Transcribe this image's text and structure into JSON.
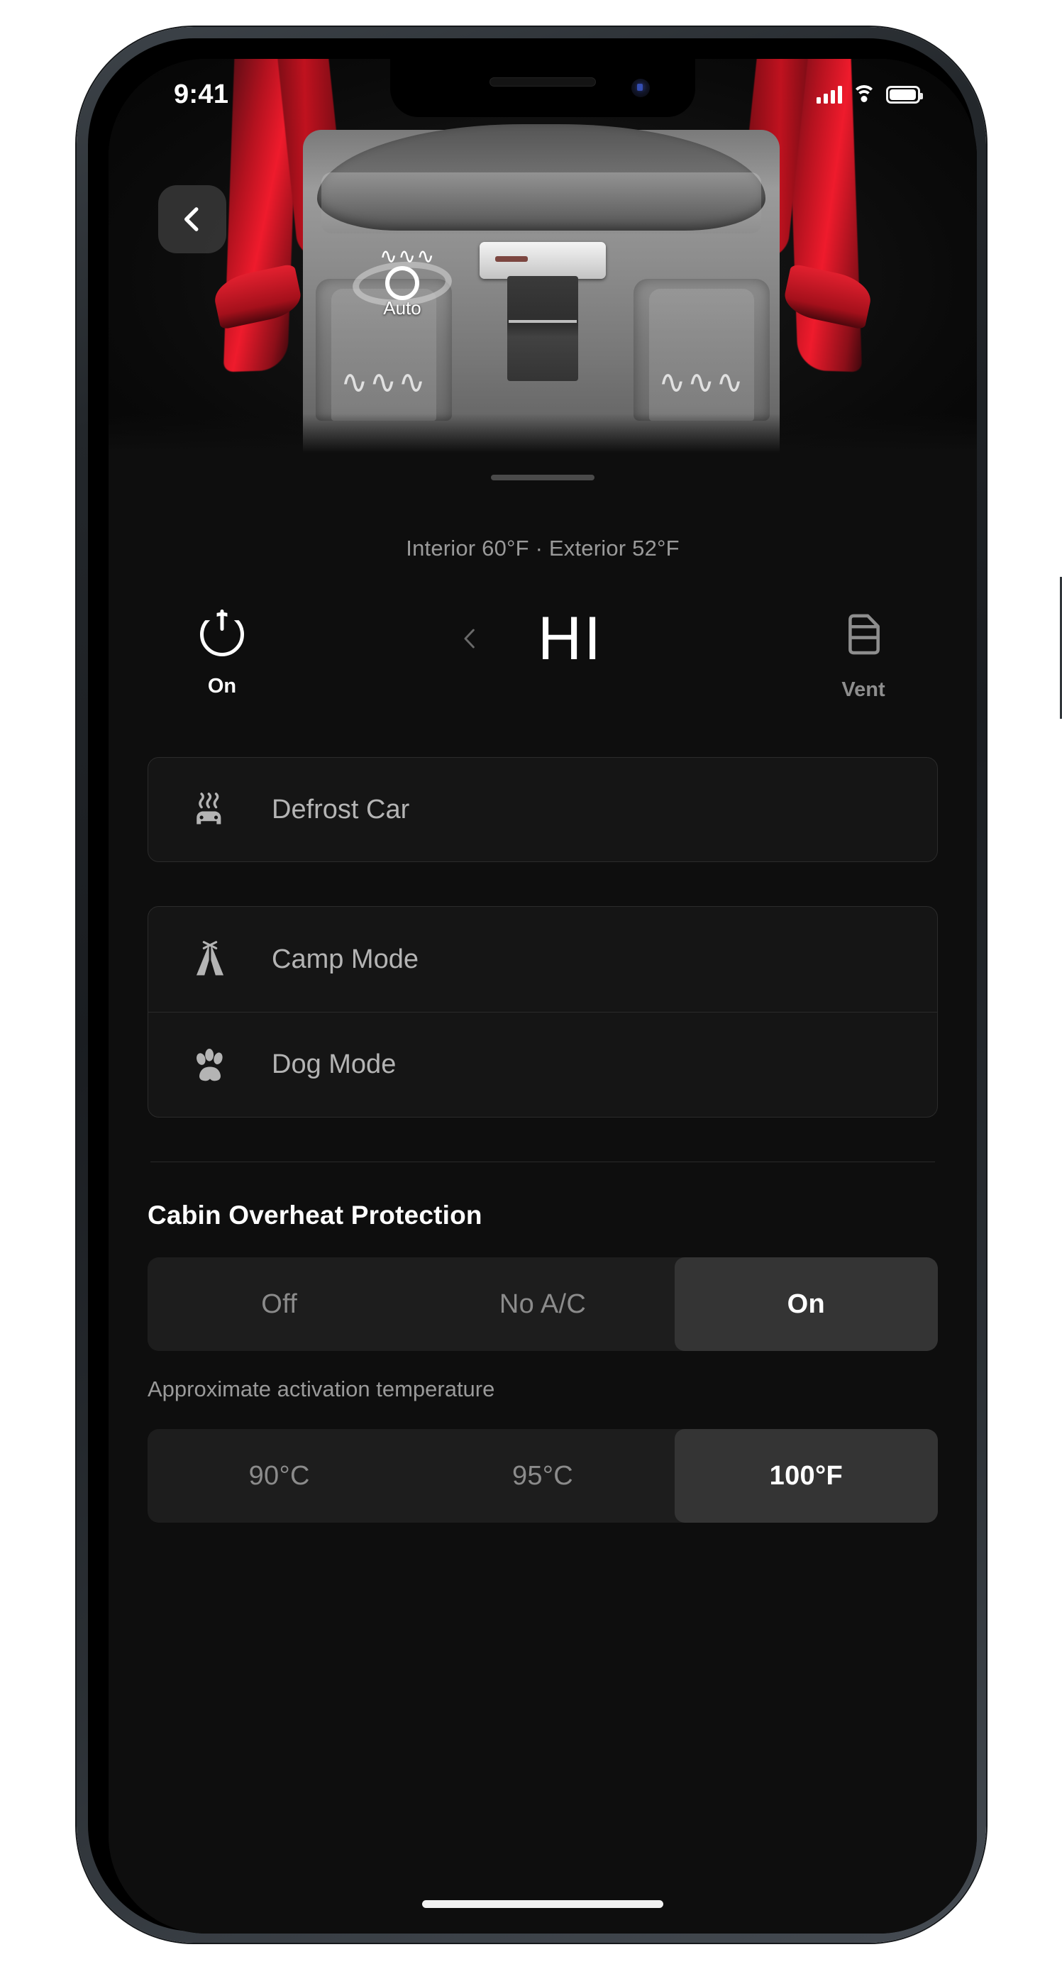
{
  "status_bar": {
    "time": "9:41",
    "cellular_icon": "cellular-signal-icon",
    "wifi_icon": "wifi-icon",
    "battery_icon": "battery-icon"
  },
  "hero": {
    "back_icon": "chevron-left-icon",
    "auto_label": "Auto",
    "steering_wheel_heat_icon": "steering-wheel-heat-icon",
    "left_seat_heat_icon": "seat-heater-icon",
    "right_seat_heat_icon": "seat-heater-icon",
    "car_color": "#ef1b2c"
  },
  "climate": {
    "temperature_readout": "Interior 60°F · Exterior 52°F",
    "power_icon": "power-icon",
    "power_label": "On",
    "temp_down_icon": "chevron-left-icon",
    "temp_value": "HI",
    "vent_icon": "car-door-vent-icon",
    "vent_label": "Vent"
  },
  "actions": {
    "defrost": {
      "label": "Defrost Car",
      "icon": "defrost-car-icon"
    },
    "camp": {
      "label": "Camp Mode",
      "icon": "tent-icon"
    },
    "dog": {
      "label": "Dog Mode",
      "icon": "paw-icon"
    }
  },
  "cabin_overheat": {
    "title": "Cabin Overheat Protection",
    "options": [
      "Off",
      "No A/C",
      "On"
    ],
    "selected": "On",
    "sub_label": "Approximate activation temperature",
    "temperature_options": [
      "90°C",
      "95°C",
      "100°F"
    ],
    "temperature_selected": "100°F"
  },
  "home_indicator": "home-indicator"
}
